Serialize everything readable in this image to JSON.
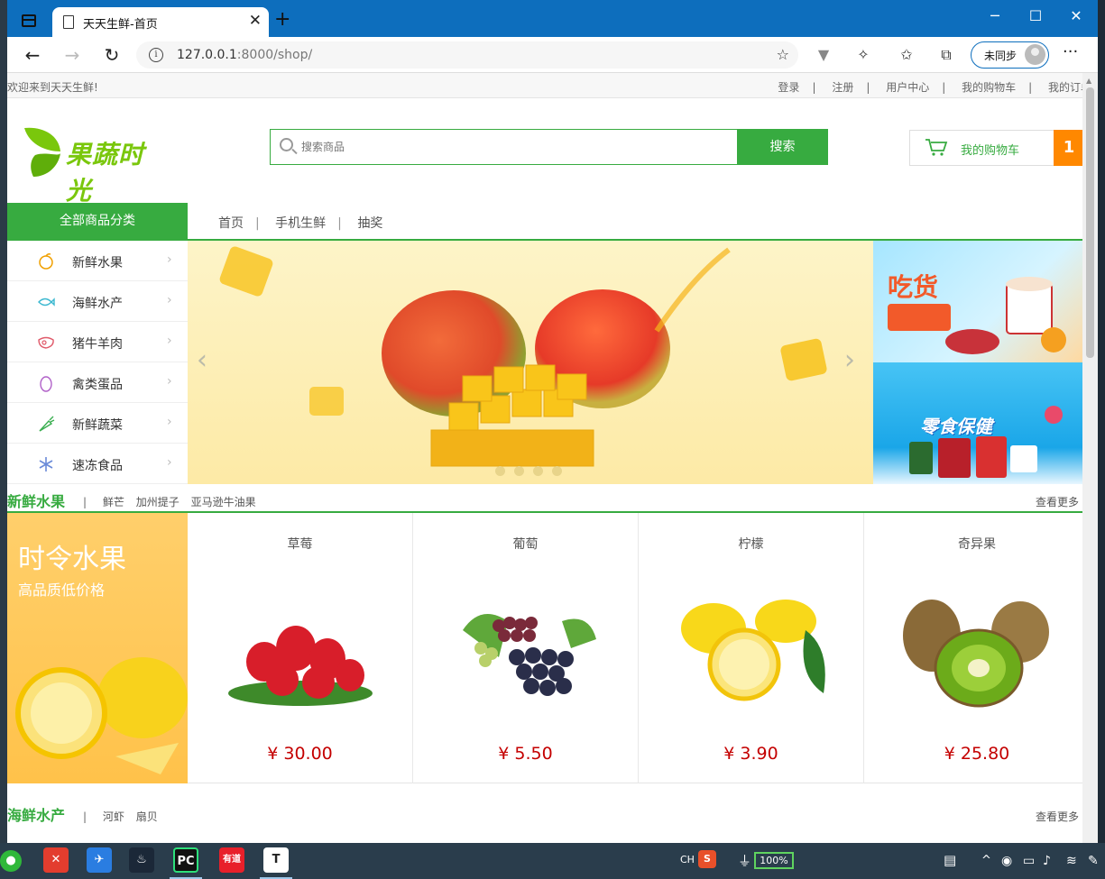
{
  "browser": {
    "tab_title": "天天生鲜-首页",
    "url_host": "127.0.0.1",
    "url_rest": ":8000/shop/",
    "profile_label": "未同步"
  },
  "topbar": {
    "welcome": "欢迎来到天天生鲜!",
    "links": [
      "登录",
      "注册",
      "用户中心",
      "我的购物车",
      "我的订单"
    ]
  },
  "header": {
    "logo_text": "果蔬时光",
    "search_placeholder": "搜索商品",
    "search_button": "搜索",
    "cart_label": "我的购物车",
    "cart_count": "1"
  },
  "navbar": {
    "all_categories": "全部商品分类",
    "links": [
      "首页",
      "手机生鲜",
      "抽奖"
    ]
  },
  "categories": [
    {
      "label": "新鲜水果",
      "icon": "fruit-icon"
    },
    {
      "label": "海鲜水产",
      "icon": "fish-icon"
    },
    {
      "label": "猪牛羊肉",
      "icon": "meat-icon"
    },
    {
      "label": "禽类蛋品",
      "icon": "egg-icon"
    },
    {
      "label": "新鲜蔬菜",
      "icon": "carrot-icon"
    },
    {
      "label": "速冻食品",
      "icon": "snowflake-icon"
    }
  ],
  "side_banners": {
    "banner1_title": "吃货",
    "banner2_title": "零食保健"
  },
  "floor1": {
    "title": "新鲜水果",
    "subs": [
      "鲜芒",
      "加州提子",
      "亚马逊牛油果"
    ],
    "more": "查看更多",
    "promo_title": "时令水果",
    "promo_sub": "高品质低价格",
    "products": [
      {
        "name": "草莓",
        "price": "¥ 30.00"
      },
      {
        "name": "葡萄",
        "price": "¥ 5.50"
      },
      {
        "name": "柠檬",
        "price": "¥ 3.90"
      },
      {
        "name": "奇异果",
        "price": "¥ 25.80"
      }
    ]
  },
  "floor2": {
    "title": "海鲜水产",
    "subs": [
      "河虾",
      "扇贝"
    ],
    "more": "查看更多"
  },
  "taskbar": {
    "ime": "CH",
    "battery": "100%"
  },
  "colors": {
    "brand_green": "#37ab40",
    "cart_orange": "#ff8800",
    "price_red": "#c40000",
    "browser_blue": "#0d6ebd"
  }
}
